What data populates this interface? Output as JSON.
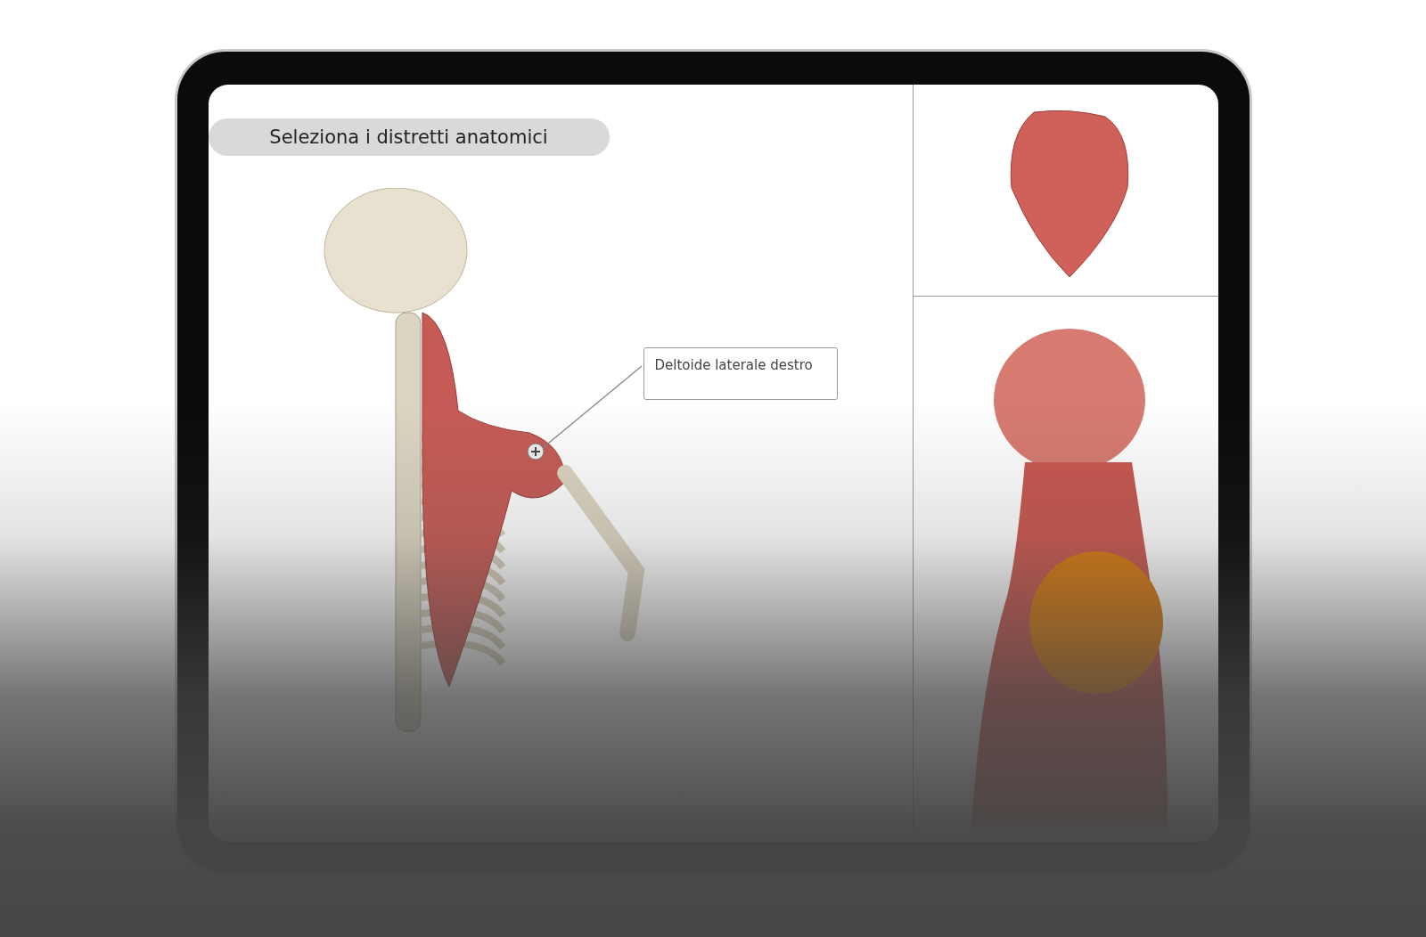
{
  "screen": {
    "title_pill": "Seleziona i distretti anatomici",
    "callout": {
      "label": "Deltoide laterale destro"
    }
  }
}
